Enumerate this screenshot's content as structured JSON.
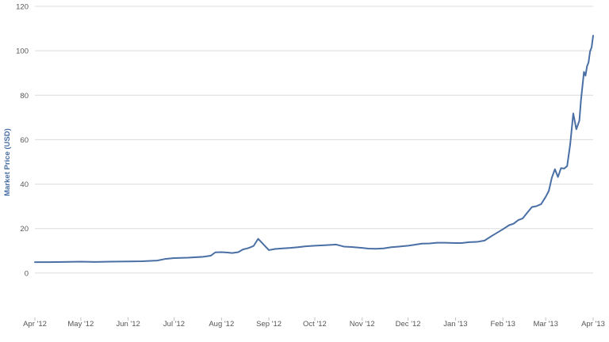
{
  "chart_data": {
    "type": "line",
    "title": "",
    "xlabel": "",
    "ylabel": "Market Price (USD)",
    "ylim": [
      -20,
      120
    ],
    "yticks": [
      0,
      20,
      40,
      60,
      80,
      100,
      120
    ],
    "xlim": [
      "2012-04-01",
      "2013-04-01"
    ],
    "xticks": [
      {
        "date": "2012-04-01",
        "label": "Apr '12"
      },
      {
        "date": "2012-05-01",
        "label": "May '12"
      },
      {
        "date": "2012-06-01",
        "label": "Jun '12"
      },
      {
        "date": "2012-07-01",
        "label": "Jul '12"
      },
      {
        "date": "2012-08-01",
        "label": "Aug '12"
      },
      {
        "date": "2012-09-01",
        "label": "Sep '12"
      },
      {
        "date": "2012-10-01",
        "label": "Oct '12"
      },
      {
        "date": "2012-11-01",
        "label": "Nov '12"
      },
      {
        "date": "2012-12-01",
        "label": "Dec '12"
      },
      {
        "date": "2013-01-01",
        "label": "Jan '13"
      },
      {
        "date": "2013-02-01",
        "label": "Feb '13"
      },
      {
        "date": "2013-03-01",
        "label": "Mar '13"
      },
      {
        "date": "2013-04-01",
        "label": "Apr '13"
      }
    ],
    "grid": true,
    "legend": "none",
    "colors": {
      "line": "#4a6fa5",
      "grid": "#dcdcdc",
      "axis_title": "#4a6fa5",
      "tick_text": "#555555"
    },
    "series": [
      {
        "x": [
          "2012-04-01",
          "2012-04-10",
          "2012-04-20",
          "2012-05-01",
          "2012-05-10",
          "2012-05-20",
          "2012-06-01",
          "2012-06-10",
          "2012-06-20",
          "2012-06-25",
          "2012-07-01",
          "2012-07-10",
          "2012-07-20",
          "2012-07-25",
          "2012-07-28",
          "2012-08-01",
          "2012-08-05",
          "2012-08-08",
          "2012-08-12",
          "2012-08-15",
          "2012-08-18",
          "2012-08-20",
          "2012-08-22",
          "2012-08-25",
          "2012-09-01",
          "2012-09-05",
          "2012-09-10",
          "2012-09-15",
          "2012-09-20",
          "2012-09-25",
          "2012-10-01",
          "2012-10-05",
          "2012-10-10",
          "2012-10-15",
          "2012-10-20",
          "2012-10-25",
          "2012-11-01",
          "2012-11-05",
          "2012-11-10",
          "2012-11-15",
          "2012-11-20",
          "2012-11-25",
          "2012-12-01",
          "2012-12-05",
          "2012-12-10",
          "2012-12-15",
          "2012-12-20",
          "2012-12-25",
          "2013-01-01",
          "2013-01-05",
          "2013-01-10",
          "2013-01-15",
          "2013-01-20",
          "2013-01-25",
          "2013-02-01",
          "2013-02-05",
          "2013-02-08",
          "2013-02-11",
          "2013-02-14",
          "2013-02-17",
          "2013-02-20",
          "2013-02-23",
          "2013-02-26",
          "2013-03-01",
          "2013-03-03",
          "2013-03-05",
          "2013-03-07",
          "2013-03-09",
          "2013-03-11",
          "2013-03-13",
          "2013-03-15",
          "2013-03-17",
          "2013-03-19",
          "2013-03-21",
          "2013-03-23",
          "2013-03-24",
          "2013-03-26",
          "2013-03-27",
          "2013-03-28",
          "2013-03-29",
          "2013-03-30",
          "2013-03-31",
          "2013-04-01"
        ],
        "y": [
          4.9,
          4.9,
          5.0,
          5.1,
          5.0,
          5.1,
          5.2,
          5.3,
          5.6,
          6.3,
          6.7,
          6.9,
          7.3,
          7.8,
          9.3,
          9.4,
          9.2,
          9.0,
          9.4,
          10.6,
          11.1,
          11.6,
          12.2,
          15.4,
          10.3,
          10.8,
          11.1,
          11.3,
          11.6,
          12.0,
          12.3,
          12.4,
          12.6,
          12.8,
          11.9,
          11.7,
          11.3,
          11.0,
          10.9,
          11.1,
          11.6,
          11.9,
          12.3,
          12.7,
          13.2,
          13.3,
          13.6,
          13.6,
          13.5,
          13.5,
          13.9,
          14.0,
          14.6,
          16.8,
          19.7,
          21.5,
          22.2,
          23.8,
          24.6,
          27.2,
          29.7,
          30.1,
          31.0,
          34.3,
          36.9,
          42.9,
          46.7,
          43.2,
          47.2,
          47.0,
          48.1,
          57.9,
          71.8,
          64.7,
          68.6,
          77.5,
          90.5,
          88.8,
          93.0,
          94.8,
          99.8,
          101.5,
          106.8
        ]
      }
    ]
  }
}
